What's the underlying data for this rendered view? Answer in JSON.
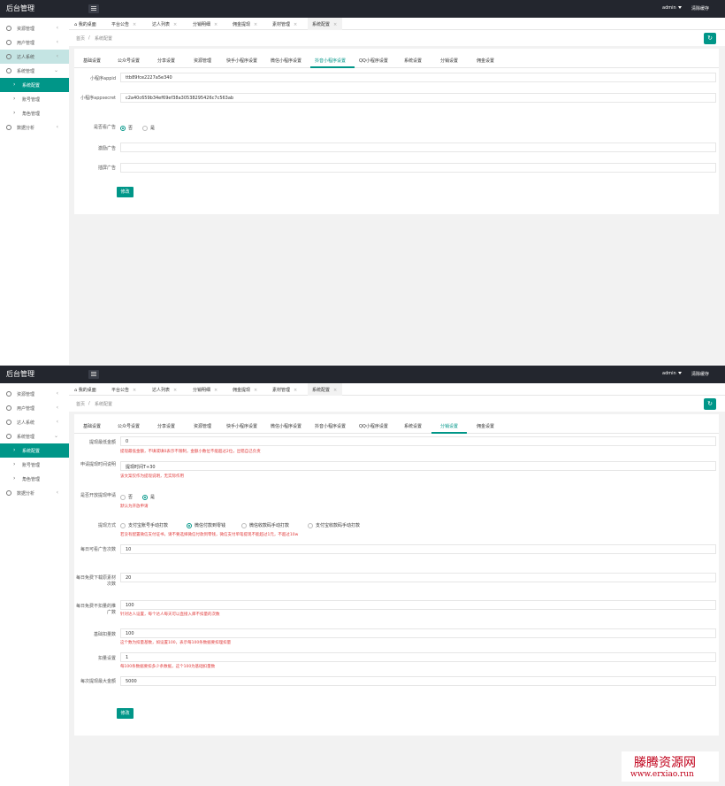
{
  "app": {
    "title": "后台管理",
    "user": "admin",
    "clear_cache": "清除缓存"
  },
  "nav": {
    "items": [
      "资源管理",
      "用户管理",
      "达人系统",
      "系统管理"
    ],
    "sub": [
      "系统配置",
      "账号管理",
      "角色管理"
    ],
    "last": "数据分析"
  },
  "tabs": [
    "我的桌面",
    "平台公告",
    "达人列表",
    "分销明细",
    "佣金提现",
    "素材管理",
    "系统配置"
  ],
  "crumb": {
    "home": "首页",
    "sep": "/",
    "current": "系统配置"
  },
  "setting_tabs": [
    "基础设置",
    "公众号设置",
    "分享设置",
    "资源管理",
    "快手小程序设置",
    "微信小程序设置",
    "抖音小程序设置",
    "QQ小程序设置",
    "系统设置",
    "分销设置",
    "佣金设置"
  ],
  "form1": {
    "appid_label": "小程序appid",
    "appid": "ttb89fce2227a5e340",
    "secret_label": "小程序appsecret",
    "secret": "c2a40c659b34ef69ef38a30538295426c7c563ab",
    "ad_label": "是否看广告",
    "no": "否",
    "yes": "是",
    "reward_label": "激励广告",
    "insert_label": "插屏广告",
    "submit": "修改"
  },
  "form2": {
    "min_label": "提现最低金额",
    "min_value": "0",
    "min_hint": "提现最低金额，不填或填0表示不限制，金额小数位不能超过2位，出错自己负责",
    "time_label": "申请提现时间说明",
    "time_value": "提现时间T+30",
    "time_hint": "该文案仅作为提现说明，无实际作用",
    "open_label": "是否开放提现申请",
    "no": "否",
    "yes": "是",
    "open_hint": "默认为开放申请",
    "method_label": "提现方式",
    "methods": [
      "支付宝账号手动打款",
      "微信付款到零钱",
      "微信收款码手动打款",
      "支付宝收款码手动打款"
    ],
    "method_hint": "若没有配置微信支付证书，请不要选择微信付款到零钱，微信支付单笔提现不能超过1元，不超过10w",
    "daily_ad_label": "每日可看广告次数",
    "daily_ad": "10",
    "daily_free_label": "每日免费下载原素材次数",
    "daily_free": "20",
    "daily_nodeduct_label": "每日免费不扣量的推广数",
    "daily_nodeduct": "100",
    "daily_nodeduct_hint": "针对达人设置，每个达人每天可以直接入库不扣量的次数",
    "base_label": "基础扣量数",
    "base_value": "100",
    "base_hint": "这个数为扣量基数，如设置100，表示每100条数据要扣理扣量",
    "deduct_label": "扣量设置",
    "deduct_value": "1",
    "deduct_hint": "每100条数据要扣多少条数据，这个100为基础扣量数",
    "max_label": "每次提现最大金额",
    "max_value": "5000",
    "submit": "修改"
  },
  "watermark": {
    "line1": "滕腾资源网",
    "line2": "www.erxiao.run"
  }
}
